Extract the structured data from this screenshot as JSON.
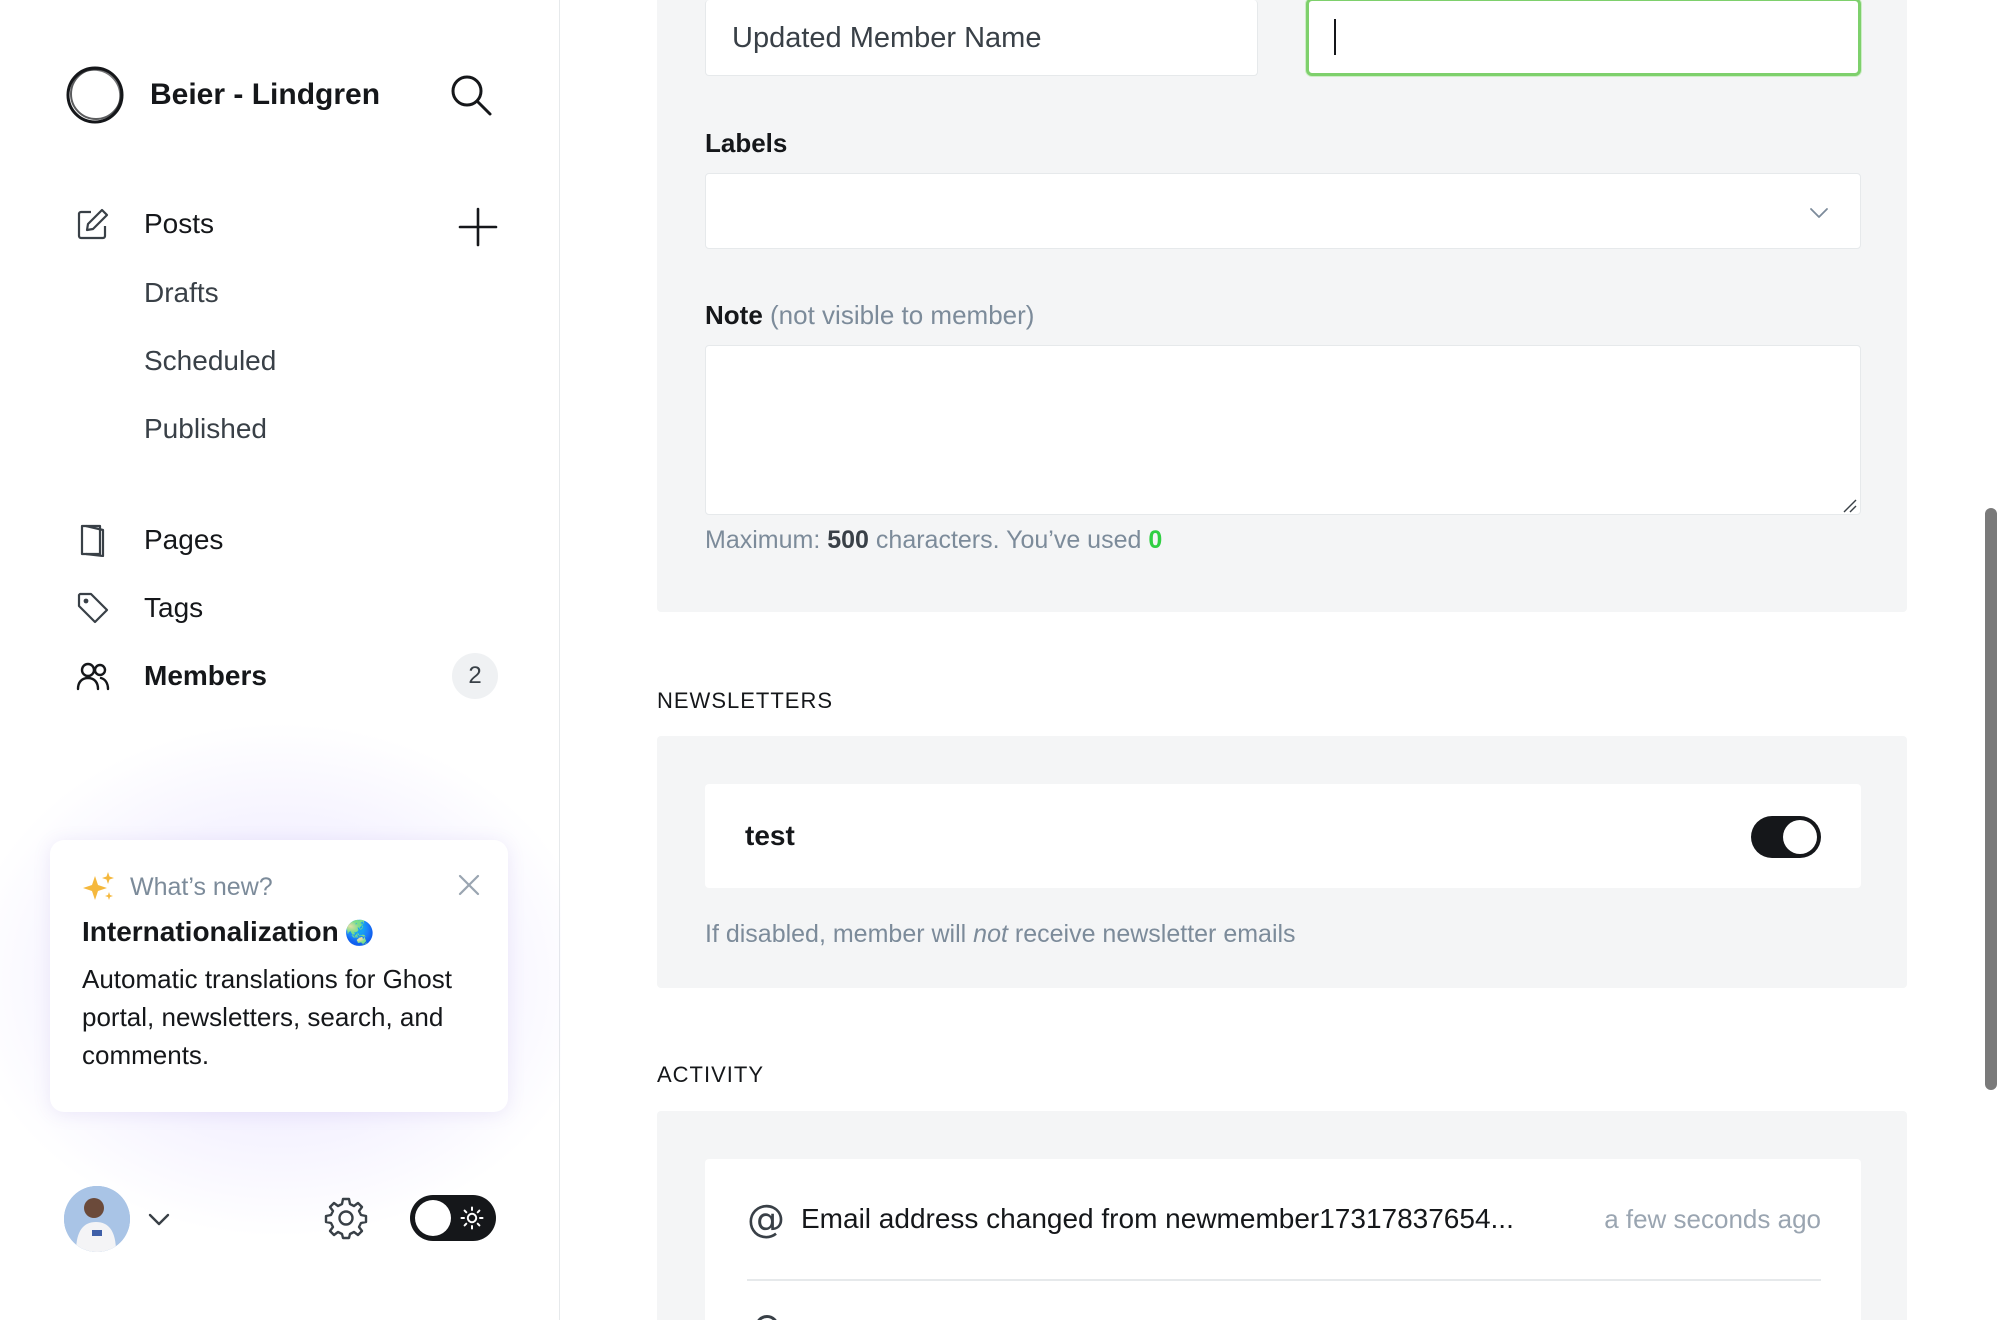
{
  "brand": {
    "name": "Beier - Lindgren"
  },
  "sidebar": {
    "posts_label": "Posts",
    "posts_sub": [
      "Drafts",
      "Scheduled",
      "Published"
    ],
    "pages_label": "Pages",
    "tags_label": "Tags",
    "members_label": "Members",
    "members_count": "2"
  },
  "whats_new": {
    "kicker": "What’s new?",
    "title": "Internationalization",
    "emoji": "🌏",
    "body": "Automatic translations for Ghost portal, newsletters, search, and comments."
  },
  "form": {
    "name_value": "Updated Member Name",
    "email_value": "",
    "labels_label": "Labels",
    "note_label": "Note",
    "note_muted": "(not visible to member)",
    "note_value": "",
    "hint_prefix": "Maximum:",
    "hint_max": "500",
    "hint_mid": "characters. You’ve used",
    "hint_used": "0"
  },
  "newsletters": {
    "section_title": "NEWSLETTERS",
    "items": [
      {
        "name": "test",
        "subscribed": true
      }
    ],
    "hint_before": "If disabled, member will",
    "hint_em": "not",
    "hint_after": "receive newsletter emails"
  },
  "activity": {
    "section_title": "ACTIVITY",
    "items": [
      {
        "icon": "@",
        "text": "Email address changed from newmember17317837654...",
        "time": "a few seconds ago"
      }
    ]
  },
  "colors": {
    "focus_border": "#7ed06c",
    "accent_green": "#30cf43",
    "panel_bg": "#f4f5f6",
    "toggle_on": "#15171a"
  },
  "icons": {
    "search": "search-icon",
    "posts": "pencil-square-icon",
    "pages": "document-icon",
    "tags": "tag-icon",
    "members": "users-icon",
    "add": "plus-icon",
    "close": "close-icon",
    "sparkle": "sparkle-icon",
    "settings": "gear-icon",
    "theme": "sun-icon"
  }
}
